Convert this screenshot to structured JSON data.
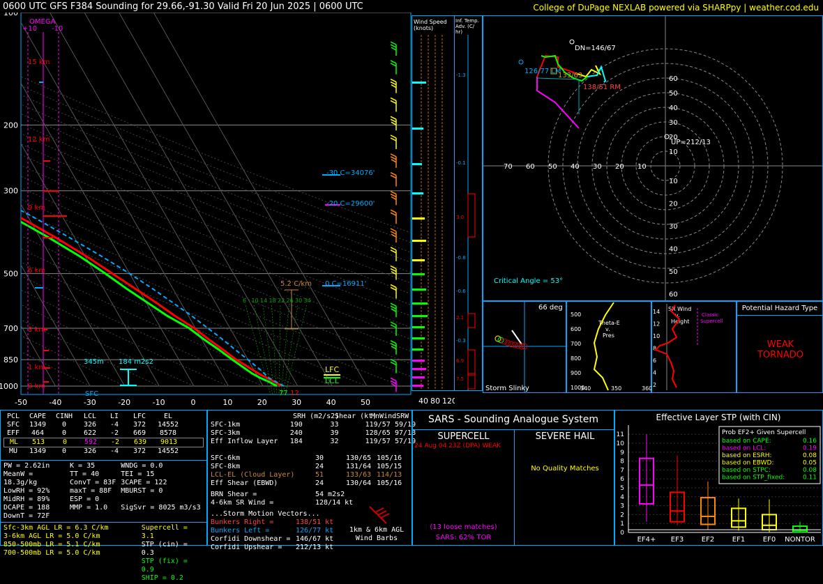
{
  "header": {
    "title": "0600 UTC GFS F384 Sounding for 29.66,-91.30 Valid  Fri 20 Jun 2025 | 0600 UTC",
    "credit": "College of DuPage NEXLAB powered via SHARPpy | weather.cod.edu"
  },
  "skewt": {
    "pressure_ticks": [
      "100",
      "200",
      "300",
      "500",
      "700",
      "850",
      "1000"
    ],
    "temp_ticks": [
      "-50",
      "-40",
      "-30",
      "-20",
      "-10",
      "0",
      "10",
      "20",
      "30",
      "40",
      "50"
    ],
    "height_labels": [
      "15 km",
      "12 km",
      "9 km",
      "6 km",
      "3 km",
      "1 km",
      "0 km"
    ],
    "omega_label": "OMEGA",
    "omega_ticks": [
      "+10",
      "-10"
    ],
    "labels": {
      "lfc": "LFC",
      "lcl": "LCL",
      "sfc": "SFC",
      "m30": "-30 C=34076'",
      "m20": "-20 C=29600'",
      "zero": "0 C=16911'",
      "lapse": "5.2 C/km",
      "eff_base": "345m",
      "srh": "184 m2s2",
      "sfc_t": "77",
      "sfc_td": "12"
    },
    "parcel_labels": [
      "6",
      "10",
      "14",
      "18",
      "22",
      "26",
      "30",
      "34"
    ]
  },
  "chart_data": {
    "type": "line",
    "title": "0600 UTC GFS F384 Sounding for 29.66,-91.30",
    "xlabel": "Temperature (C)",
    "ylabel": "Pressure (hPa)",
    "xlim": [
      -50,
      50
    ],
    "ylim": [
      1000,
      100
    ],
    "series": [
      {
        "name": "Temperature",
        "color": "#ff0000",
        "points": [
          [
            1000,
            25.5
          ],
          [
            975,
            24
          ],
          [
            950,
            22.4
          ],
          [
            925,
            20.7
          ],
          [
            900,
            19.4
          ],
          [
            850,
            16.6
          ],
          [
            800,
            14.5
          ],
          [
            750,
            12.0
          ],
          [
            700,
            9.6
          ],
          [
            650,
            6.2
          ],
          [
            600,
            3.0
          ],
          [
            550,
            -0.8
          ],
          [
            500,
            -5.0
          ],
          [
            450,
            -9.6
          ],
          [
            400,
            -15.5
          ],
          [
            350,
            -23
          ],
          [
            300,
            -31
          ],
          [
            250,
            -41
          ],
          [
            200,
            -52
          ],
          [
            175,
            -59
          ],
          [
            150,
            -68
          ],
          [
            125,
            -75
          ],
          [
            100,
            -79
          ]
        ]
      },
      {
        "name": "Dewpoint",
        "color": "#00ff00",
        "points": [
          [
            1000,
            24.0
          ],
          [
            975,
            22.5
          ],
          [
            950,
            20.5
          ],
          [
            925,
            18.9
          ],
          [
            900,
            17.8
          ],
          [
            850,
            15.5
          ],
          [
            800,
            13.3
          ],
          [
            750,
            10.6
          ],
          [
            700,
            8.2
          ],
          [
            650,
            4.0
          ],
          [
            600,
            0.5
          ],
          [
            550,
            -3.3
          ],
          [
            500,
            -7.0
          ],
          [
            450,
            -11.5
          ],
          [
            400,
            -17.5
          ],
          [
            350,
            -25
          ],
          [
            300,
            -33
          ],
          [
            250,
            -45
          ],
          [
            200,
            -58
          ],
          [
            175,
            -63
          ],
          [
            150,
            -72
          ],
          [
            125,
            -80
          ],
          [
            100,
            -86
          ]
        ]
      },
      {
        "name": "Parcel",
        "color": "#00aaff",
        "points": [
          [
            1000,
            26.0
          ],
          [
            950,
            23.0
          ],
          [
            900,
            21.8
          ],
          [
            850,
            20.0
          ],
          [
            800,
            18.0
          ],
          [
            750,
            16.0
          ],
          [
            700,
            13.6
          ],
          [
            650,
            11.0
          ],
          [
            600,
            7.8
          ],
          [
            550,
            4.2
          ],
          [
            500,
            0.0
          ],
          [
            450,
            -5.2
          ],
          [
            400,
            -11.5
          ],
          [
            350,
            -19.0
          ],
          [
            300,
            -28.5
          ],
          [
            250,
            -40
          ],
          [
            200,
            -54
          ],
          [
            175,
            -62
          ],
          [
            150,
            -71
          ],
          [
            125,
            -80
          ],
          [
            100,
            -88
          ]
        ]
      }
    ]
  },
  "winds": {
    "title": "Wind Speed (knots)",
    "ticks": [
      "40",
      "80",
      "120"
    ]
  },
  "inferred": {
    "title": "Inf. Temp. Adv. (C/hr)",
    "values": [
      "-1.3",
      "-0.1",
      "3.0",
      "-0.8",
      "-0.6",
      "2.1",
      "-0.3",
      "6.9",
      "7.5"
    ]
  },
  "hodograph": {
    "ring_labels": [
      "60",
      "50",
      "40",
      "30",
      "20",
      "10",
      "70",
      "60",
      "50",
      "40",
      "30",
      "20",
      "10",
      "10",
      "20",
      "30",
      "40",
      "50",
      "60"
    ],
    "dn": "DN=146/67",
    "up": "UP=212/13",
    "lm": "126/77 LM",
    "mean": "133/63",
    "rm": "138/51 RM",
    "critical": "Critical Angle = 53°"
  },
  "slinky": {
    "deg": "66 deg",
    "label": "Storm Slinky"
  },
  "thetae": {
    "label": "Theta-E v. Pres",
    "y_ticks": [
      "500",
      "600",
      "700",
      "800",
      "900",
      "1000"
    ],
    "x_ticks": [
      "340",
      "350",
      "360"
    ]
  },
  "srwind": {
    "label": "SR Wind v. Height",
    "classic": "Classic Supercell",
    "y_ticks": [
      "14",
      "12",
      "10",
      "8",
      "6",
      "4",
      "2"
    ]
  },
  "hazard": {
    "title": "Potential Hazard Type",
    "value": "WEAK TORNADO"
  },
  "parcels": {
    "headers": [
      "PCL",
      "CAPE",
      "CINH",
      "LCL",
      "LI",
      "LFC",
      "EL"
    ],
    "rows": [
      [
        "SFC",
        "1349",
        "0",
        "326",
        "-4",
        "372",
        "14552"
      ],
      [
        "EFF",
        "464",
        "0",
        "622",
        "-2",
        "669",
        "8578"
      ],
      [
        "ML",
        "513",
        "0",
        "592",
        "-2",
        "639",
        "9013"
      ],
      [
        "MU",
        "1349",
        "0",
        "326",
        "-4",
        "372",
        "14552"
      ]
    ]
  },
  "indices": {
    "col1": [
      "PW = 2.62in",
      "MeanW = 18.3g/kg",
      "LowRH = 92%",
      "MidRH = 89%",
      "DCAPE = 188",
      "DownT = 72F"
    ],
    "col2": [
      "K = 35",
      "TT = 40",
      "ConvT = 83F",
      "maxT = 88F",
      "ESP = 0",
      "MMP = 1.0"
    ],
    "col3": [
      "WNDG = 0.0",
      "TEI = 15",
      "3CAPE = 122",
      "MBURST = 0",
      "",
      "SigSvr = 8025 m3/s3"
    ]
  },
  "lapse_rates": [
    "Sfc-3km AGL LR = 6.3 C/km",
    "3-6km AGL LR = 5.0 C/km",
    "850-500mb LR = 5.1 C/km",
    "700-500mb LR = 5.0 C/km"
  ],
  "composite": [
    "Supercell = 3.1",
    "STP (cin) = 0.3",
    "STP (fix) = 0.9",
    "SHIP = 0.2"
  ],
  "kinematics": {
    "headers": [
      "SRH (m2/s2)",
      "Shear (kt)",
      "MnWind",
      "SRW"
    ],
    "rows": [
      [
        "SFC-1km",
        "190",
        "33",
        "119/57",
        "59/19"
      ],
      [
        "SFC-3km",
        "240",
        "39",
        "128/65",
        "97/18"
      ],
      [
        "Eff Inflow Layer",
        "184",
        "32",
        "119/57",
        "57/19"
      ],
      [
        "",
        "",
        "",
        "",
        ""
      ],
      [
        "SFC-6km",
        "30",
        "130/65",
        "105/16",
        ""
      ],
      [
        "SFC-8km",
        "24",
        "131/64",
        "105/15",
        ""
      ],
      [
        "LCL-EL (Cloud Layer)",
        "51",
        "133/63",
        "114/13",
        ""
      ],
      [
        "Eff Shear (EBWD)",
        "24",
        "130/64",
        "105/16",
        ""
      ]
    ],
    "brn": "BRN Shear =",
    "brn_val": "54 m2s2",
    "sr46": "4-6km SR Wind =",
    "sr46_val": "128/14 kt",
    "motion_title": "...Storm Motion Vectors...",
    "motions": [
      [
        "Bunkers Right =",
        "138/51 kt"
      ],
      [
        "Bunkers Left =",
        "126/77 kt"
      ],
      [
        "Corfidi Downshear =",
        "146/67 kt"
      ],
      [
        "Corfidi Upshear =",
        "212/13 kt"
      ]
    ],
    "barbs_label": "1km & 6km AGL Wind Barbs"
  },
  "sars": {
    "title": "SARS - Sounding Analogue System",
    "supercell": "SUPERCELL",
    "hail": "SEVERE HAIL",
    "match": "24 Aug 04 23Z (DPA) WEAK",
    "no_match": "No Quality Matches",
    "loose": "(13 loose matches)",
    "tor": "SARS: 62% TOR"
  },
  "stp": {
    "title": "Effective Layer STP (with CIN)",
    "categories": [
      "EF4+",
      "EF3",
      "EF2",
      "EF1",
      "EF0",
      "NONTOR"
    ],
    "y_ticks": [
      "0",
      "1",
      "2",
      "3",
      "4",
      "5",
      "6",
      "7",
      "8",
      "9",
      "10",
      "11"
    ],
    "legend_title": "Prob EF2+ Given Supercell",
    "legend": [
      [
        "based on CAPE:",
        "0.16"
      ],
      [
        "based on LCL:",
        "0.19"
      ],
      [
        "based on ESRH:",
        "0.08"
      ],
      [
        "based on EBWD:",
        "0.05"
      ],
      [
        "based on STPC:",
        "0.08"
      ],
      [
        "based on STP_fixed:",
        "0.11"
      ]
    ]
  },
  "colors": {
    "temp": "#ff0000",
    "dewp": "#00ff00",
    "parcel": "#00aaff",
    "border": "#00aaff",
    "magenta": "#ff00ff",
    "yellow": "#ffff00",
    "cyan": "#00ffff"
  }
}
